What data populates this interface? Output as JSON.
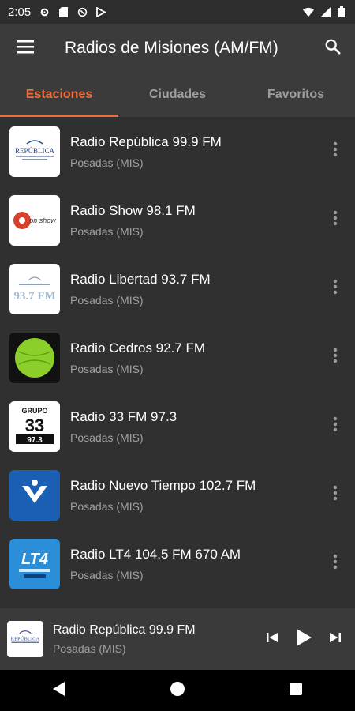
{
  "status_bar": {
    "time": "2:05",
    "icons_left": [
      "settings-icon",
      "sd-card-icon",
      "vpn-icon",
      "play-store-icon"
    ],
    "icons_right": [
      "wifi-icon",
      "signal-icon",
      "battery-icon"
    ]
  },
  "app_bar": {
    "title": "Radios de Misiones (AM/FM)",
    "menu_icon": "menu-icon",
    "search_icon": "search-icon"
  },
  "tabs": [
    {
      "label": "Estaciones",
      "active": true
    },
    {
      "label": "Ciudades",
      "active": false
    },
    {
      "label": "Favoritos",
      "active": false
    }
  ],
  "stations": [
    {
      "name": "Radio República 99.9 FM",
      "city": "Posadas (MIS)",
      "logo_text": "REPÚBLICA"
    },
    {
      "name": "Radio Show 98.1 FM",
      "city": "Posadas (MIS)",
      "logo_text": "on show"
    },
    {
      "name": "Radio Libertad 93.7 FM",
      "city": "Posadas (MIS)",
      "logo_text": "93.7 FM"
    },
    {
      "name": "Radio Cedros 92.7 FM",
      "city": "Posadas (MIS)",
      "logo_text": ""
    },
    {
      "name": "Radio 33 FM 97.3",
      "city": "Posadas (MIS)",
      "logo_text": "GRUPO 33 97.3"
    },
    {
      "name": "Radio Nuevo Tiempo 102.7 FM",
      "city": "Posadas (MIS)",
      "logo_text": ""
    },
    {
      "name": "Radio LT4 104.5 FM 670 AM",
      "city": "Posadas (MIS)",
      "logo_text": "LT4"
    }
  ],
  "now_playing": {
    "title": "Radio República 99.9 FM",
    "subtitle": "Posadas (MIS)",
    "logo_text": "REPÚBLICA"
  },
  "colors": {
    "accent": "#f26b3a",
    "app_bar": "#3b3b3b",
    "background": "#303030"
  }
}
